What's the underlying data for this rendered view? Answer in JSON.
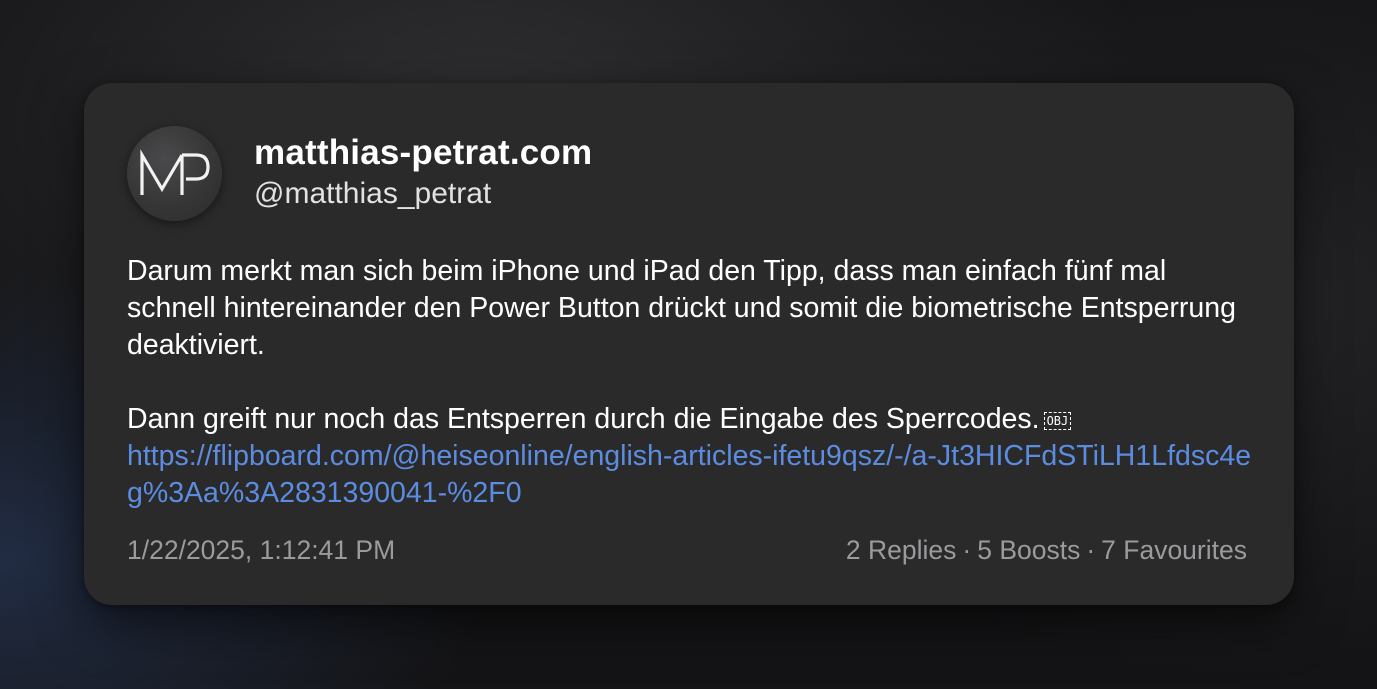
{
  "post": {
    "display_name": "matthias-petrat.com",
    "handle": "@matthias_petrat",
    "avatar_initials": "MP",
    "paragraph1": "Darum merkt man sich beim iPhone und iPad den Tipp, dass man einfach fünf mal schnell hintereinander den Power Button drückt und somit die biometrische Entsperrung deaktiviert.",
    "paragraph2": "Dann greift nur noch das Entsperren durch die Eingabe des Sperrcodes.",
    "object_glyph": "OBJ",
    "link": "https://flipboard.com/@heiseonline/english-articles-ifetu9qsz/-/a-Jt3HICFdSTiLH1Lfdsc4eg%3Aa%3A2831390041-%2F0",
    "timestamp": "1/22/2025, 1:12:41 PM",
    "replies": "2 Replies",
    "boosts": "5 Boosts",
    "favourites": "7 Favourites",
    "separator": "·"
  },
  "colors": {
    "card_background": "#2a2a2b",
    "link": "#5c8ce0",
    "meta_text": "#9b9b9e"
  }
}
